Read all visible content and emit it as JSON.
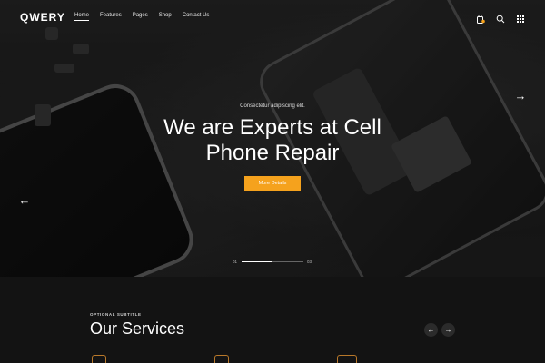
{
  "header": {
    "logo": "QWERY",
    "nav": [
      {
        "label": "Home",
        "active": true
      },
      {
        "label": "Features",
        "active": false
      },
      {
        "label": "Pages",
        "active": false
      },
      {
        "label": "Shop",
        "active": false
      },
      {
        "label": "Contact Us",
        "active": false
      }
    ],
    "icons": [
      "cart-icon",
      "search-icon",
      "grid-menu-icon"
    ],
    "cart_badge_color": "#f5a21d"
  },
  "hero": {
    "eyebrow": "Consectetur adipiscing elit.",
    "title_line1": "We are Experts at Cell",
    "title_line2": "Phone Repair",
    "cta_label": "More Details",
    "prev_arrow": "←",
    "next_arrow": "→",
    "slider": {
      "current": "01",
      "total": "03",
      "progress": 0.5
    }
  },
  "services": {
    "subtitle": "OPTIONAL SUBTITLE",
    "title": "Our Services",
    "prev_label": "←",
    "next_label": "→"
  },
  "colors": {
    "accent": "#f5a21d",
    "background": "#131313"
  }
}
